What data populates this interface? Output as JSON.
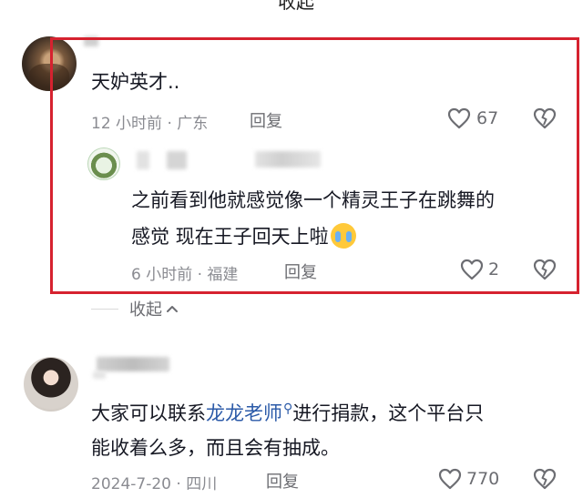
{
  "top_partial": {
    "text": "收起"
  },
  "comments": [
    {
      "text": "天妒英才..",
      "meta": "12 小时前 · 广东",
      "reply_label": "回复",
      "like_count": "67",
      "highlighted": true,
      "replies": [
        {
          "text_line1": "之前看到他就感觉像一个精灵王子在跳舞的",
          "text_line2": "感觉  现在王子回天上啦",
          "meta": "6 小时前 · 福建",
          "reply_label": "回复",
          "like_count": "2"
        }
      ],
      "collapse_label": "收起"
    },
    {
      "text_before": "大家可以联系",
      "mention": "龙龙老师",
      "text_after_line1": "进行捐款，这个平台只",
      "text_line2": "能收着么多，而且会有抽成。",
      "meta": "2024-7-20 · 四川",
      "reply_label": "回复",
      "like_count": "770"
    }
  ],
  "icons": {
    "like": "heart-outline-icon",
    "dislike": "broken-heart-icon",
    "collapse": "chevron-up-icon",
    "mention_search": "search-icon",
    "emoji": "crying-face-emoji"
  },
  "colors": {
    "highlight_border": "#d6222f",
    "mention": "#2b5aa8",
    "meta_text": "#8a8b91",
    "emoji_yellow": "#ffc93a"
  }
}
